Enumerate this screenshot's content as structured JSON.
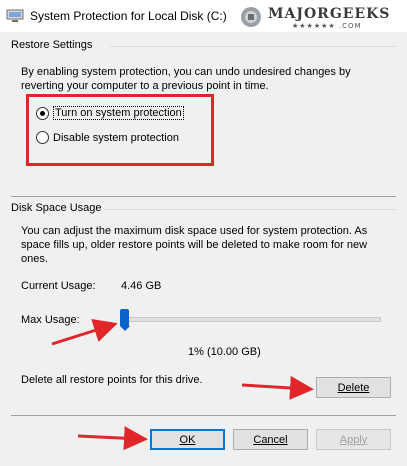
{
  "window": {
    "title": "System Protection for Local Disk (C:)",
    "watermark": "MAJORGEEKS",
    "watermark_sub": "★★★★★★ .COM"
  },
  "restore": {
    "section_title": "Restore Settings",
    "description": "By enabling system protection, you can undo undesired changes by reverting your computer to a previous point in time.",
    "options": [
      {
        "label": "Turn on system protection",
        "selected": true
      },
      {
        "label": "Disable system protection",
        "selected": false
      }
    ]
  },
  "disk": {
    "section_title": "Disk Space Usage",
    "description": "You can adjust the maximum disk space used for system protection. As space fills up, older restore points will be deleted to make room for new ones.",
    "current_usage_label": "Current Usage:",
    "current_usage_value": "4.46 GB",
    "max_usage_label": "Max Usage:",
    "max_usage_display": "1% (10.00 GB)",
    "max_usage_percent": 1,
    "delete_text": "Delete all restore points for this drive.",
    "delete_button": "Delete"
  },
  "buttons": {
    "ok": "OK",
    "cancel": "Cancel",
    "apply": "Apply"
  },
  "colors": {
    "highlight_box": "#e0252b",
    "arrow": "#e0252b",
    "slider_thumb": "#0a63c9"
  }
}
